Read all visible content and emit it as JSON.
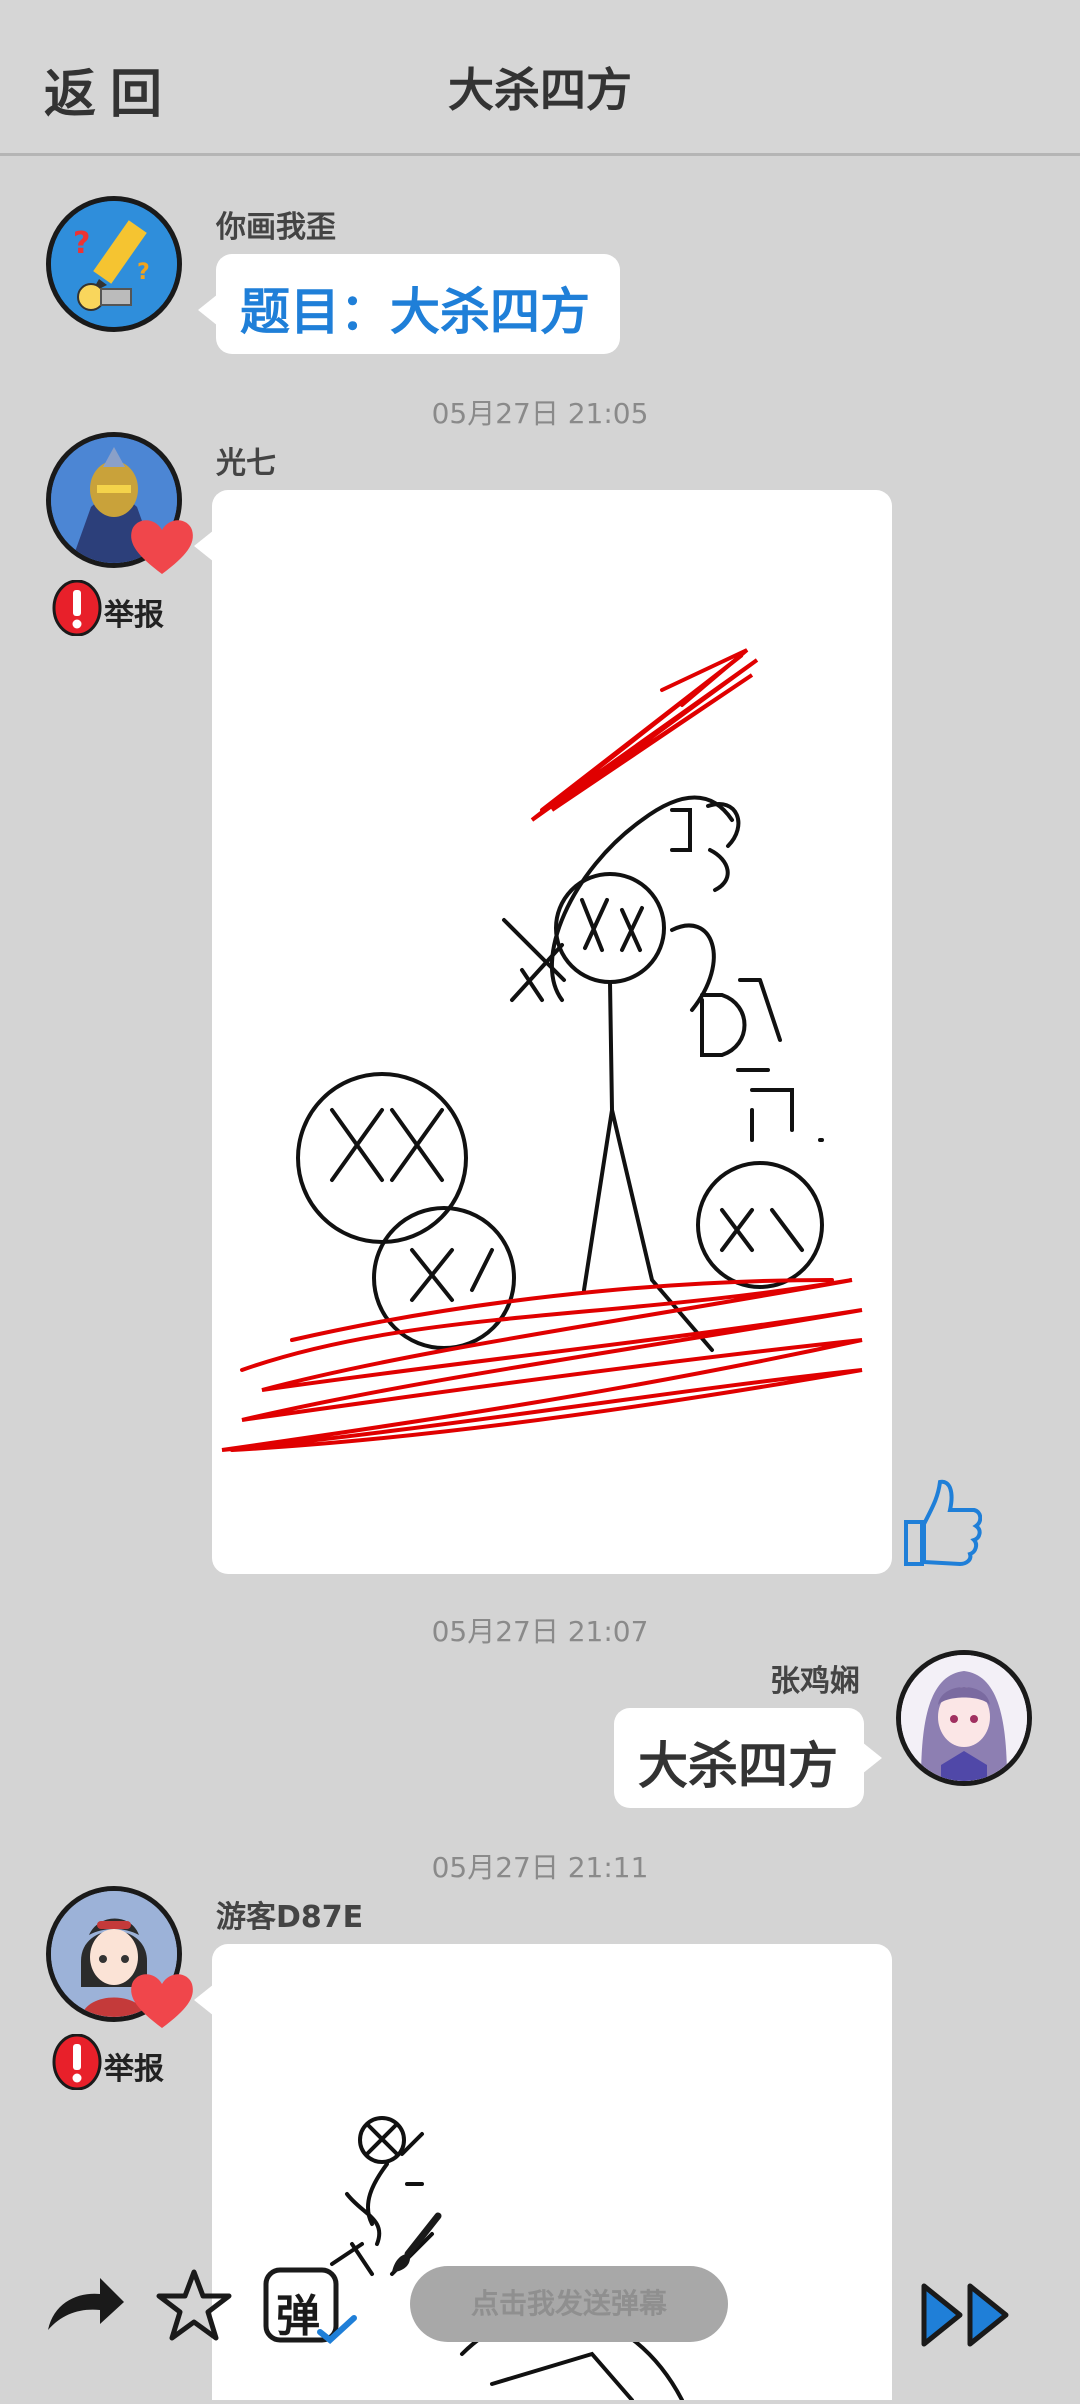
{
  "header": {
    "back_label": "返回",
    "title": "大杀四方"
  },
  "messages": {
    "system": {
      "sender": "你画我歪",
      "prompt": "题目：大杀四方"
    },
    "post1": {
      "time": "05月27日  21:05",
      "sender": "光七",
      "report_label": "举报"
    },
    "reply1": {
      "time": "05月27日  21:07",
      "sender": "张鸡娴",
      "text": "大杀四方"
    },
    "post2": {
      "time": "05月27日  21:11",
      "sender": "游客D87E",
      "report_label": "举报"
    }
  },
  "bottom_bar": {
    "danmaku_badge": "弹",
    "danmaku_placeholder": "点击我发送弹幕"
  },
  "colors": {
    "background": "#d4d4d4",
    "accent_blue": "#1f7fd8",
    "heart_red": "#f0464b",
    "report_red": "#e8202a",
    "drawing_red": "#e00000"
  },
  "icons": [
    "share-icon",
    "star-icon",
    "danmaku-icon",
    "fast-forward-icon",
    "heart-icon",
    "alert-icon",
    "thumbs-up-icon",
    "pencil-icon"
  ]
}
